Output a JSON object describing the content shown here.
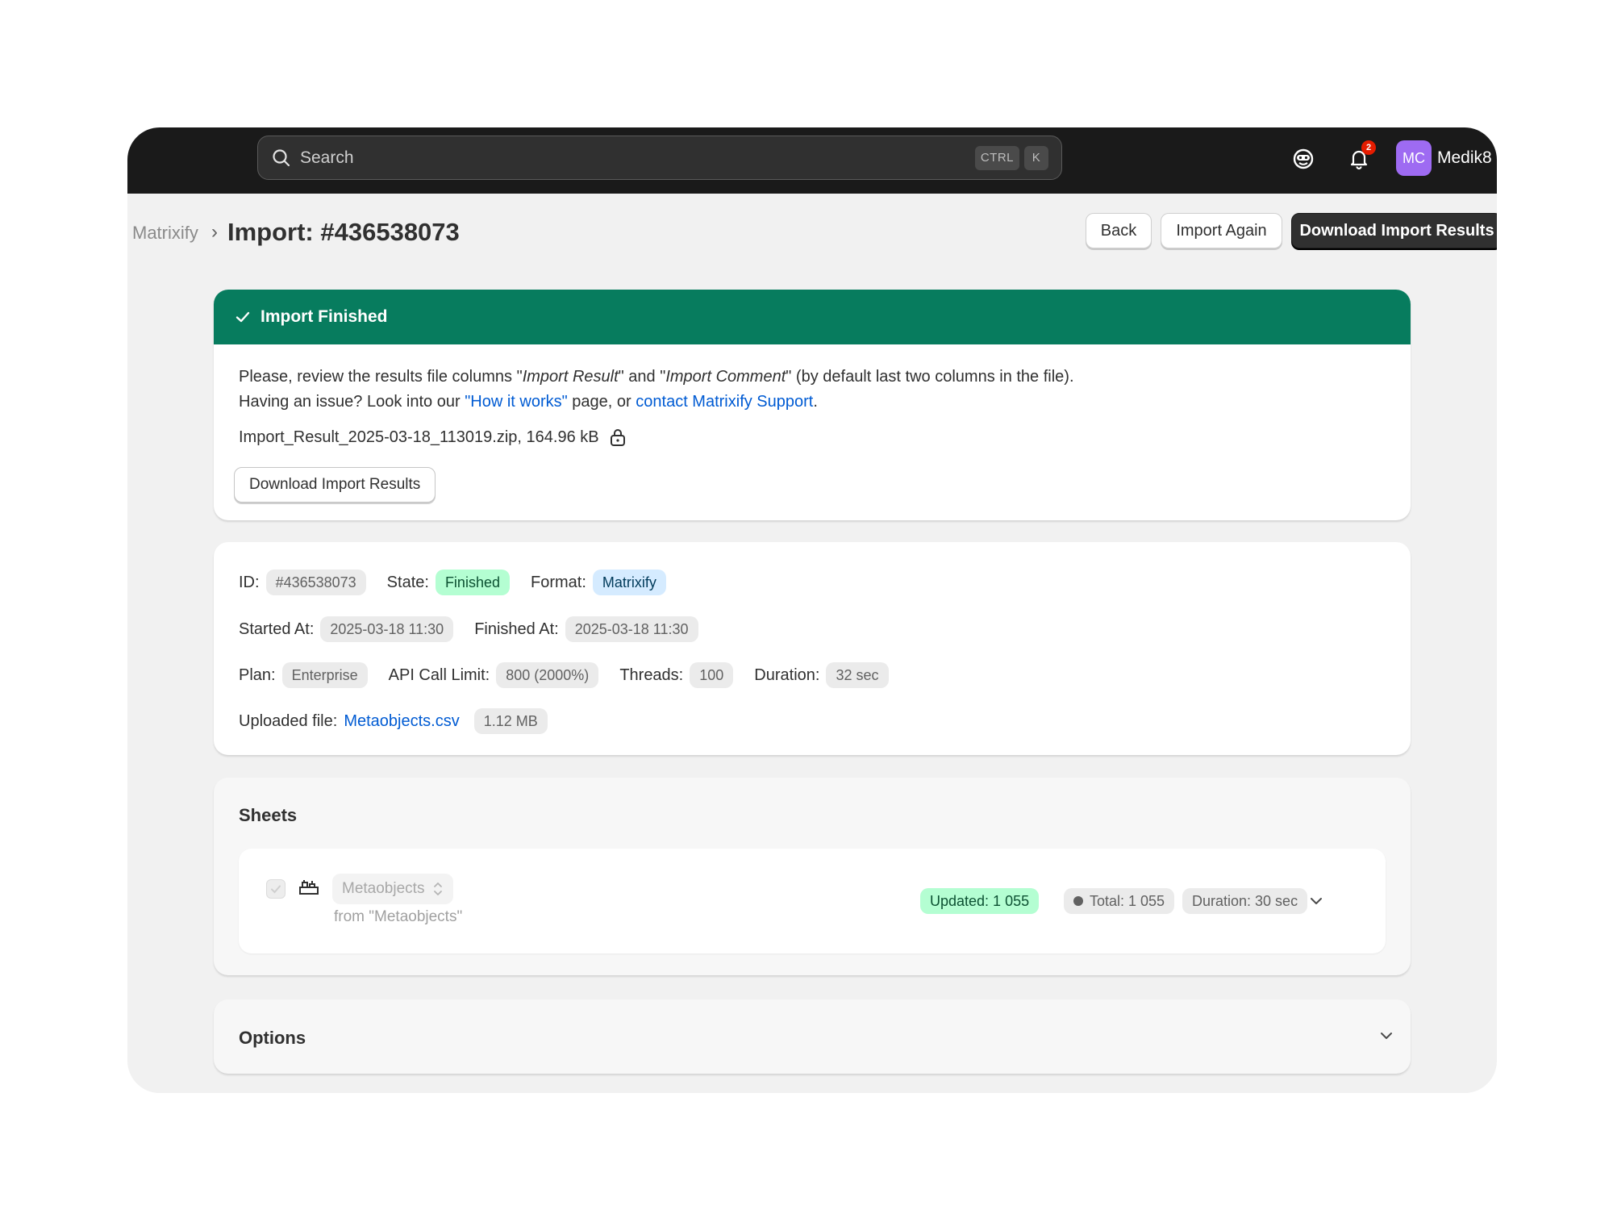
{
  "topbar": {
    "search_placeholder": "Search",
    "shortcut_keys": [
      "CTRL",
      "K"
    ],
    "notification_count": "2",
    "avatar_initials": "MC",
    "store_name": "Medik8",
    "icons": [
      "search-icon",
      "sidekick-icon",
      "bell-icon"
    ]
  },
  "header": {
    "breadcrumb": "Matrixify",
    "breadcrumb_separator": "›",
    "title": "Import: #436538073",
    "back_label": "Back",
    "import_again_label": "Import Again",
    "download_label": "Download Import Results"
  },
  "banner": {
    "title": "Import Finished",
    "line1_prefix": "Please, review the results file columns \"",
    "line1_em1": "Import Result",
    "line1_mid": "\" and \"",
    "line1_em2": "Import Comment",
    "line1_suffix": "\" (by default last two columns in the file).",
    "line2_prefix": "Having an issue? Look into our ",
    "line2_link1": "\"How it works\"",
    "line2_mid": " page, or ",
    "line2_link2": "contact Matrixify Support",
    "line2_suffix": ".",
    "file_info": "Import_Result_2025-03-18_113019.zip, 164.96 kB",
    "download_button": "Download Import Results"
  },
  "details": {
    "id_label": "ID:",
    "id_value": "#436538073",
    "state_label": "State:",
    "state_value": "Finished",
    "format_label": "Format:",
    "format_value": "Matrixify",
    "started_label": "Started At:",
    "started_value": "2025-03-18 11:30",
    "finished_label": "Finished At:",
    "finished_value": "2025-03-18 11:30",
    "plan_label": "Plan:",
    "plan_value": "Enterprise",
    "api_label": "API Call Limit:",
    "api_value": "800 (2000%)",
    "threads_label": "Threads:",
    "threads_value": "100",
    "duration_label": "Duration:",
    "duration_value": "32 sec",
    "uploaded_label": "Uploaded file:",
    "uploaded_file": "Metaobjects.csv",
    "uploaded_size": "1.12 MB"
  },
  "sheets": {
    "title": "Sheets",
    "items": [
      {
        "name": "Metaobjects",
        "source": "from \"Metaobjects\"",
        "updated": "Updated: 1 055",
        "total": "Total: 1 055",
        "duration": "Duration: 30 sec"
      }
    ]
  },
  "options": {
    "title": "Options"
  },
  "colors": {
    "banner_green": "#077c5e",
    "topbar": "#1a1a1a",
    "link_blue": "#005bd3",
    "success_pill": "#b4fed2",
    "info_pill": "#d5ebff",
    "avatar_purple": "#9e6bf2",
    "badge_red": "#e51c00"
  }
}
